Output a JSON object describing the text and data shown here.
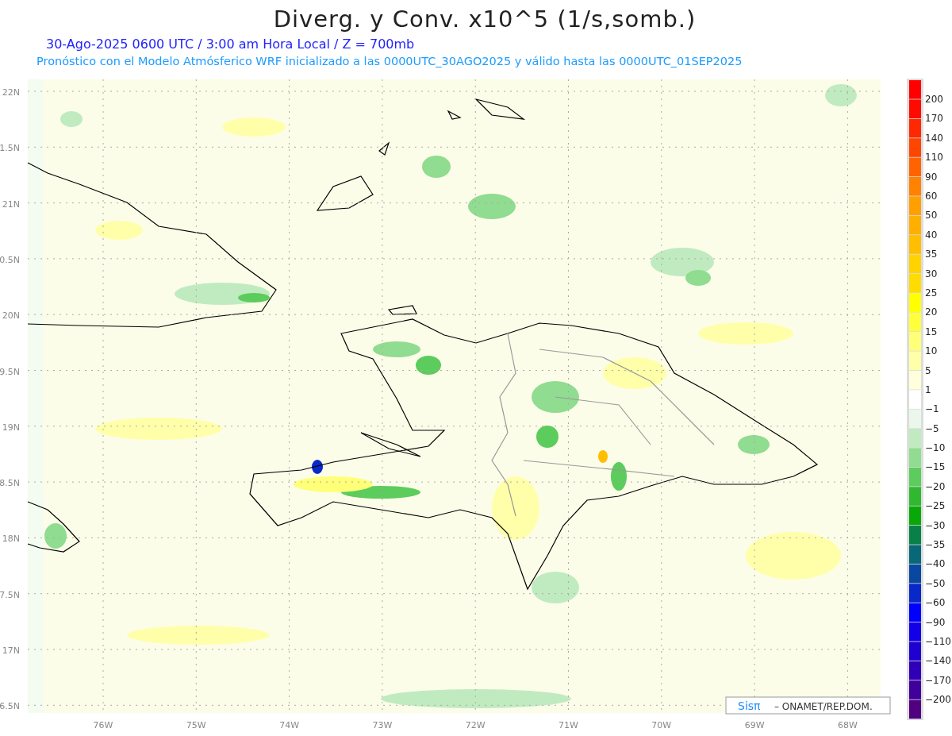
{
  "title": "Diverg. y Conv. x10^5 (1/s,somb.)",
  "subtitle": "30-Ago-2025  0600 UTC / 3:00 am Hora Local / Z = 700mb",
  "forecast_note": "Pronóstico con el Modelo Atmósferico WRF inicializado a las 0000UTC_30AGO2025 y válido hasta las  0000UTC_01SEP2025",
  "map": {
    "lat_labels": [
      "22N",
      "1.5N",
      "21N",
      "0.5N",
      "20N",
      "9.5N",
      "19N",
      "8.5N",
      "18N",
      "7.5N",
      "17N",
      "6.5N"
    ],
    "lon_labels": [
      "76W",
      "75W",
      "74W",
      "73W",
      "72W",
      "71W",
      "70W",
      "69W",
      "68W"
    ]
  },
  "credit": {
    "logo": "Sisπ",
    "text": "– ONAMET/REP.DOM."
  },
  "color_scale": {
    "segments": [
      {
        "color": "#ff0000"
      },
      {
        "color": "#ff0a00"
      },
      {
        "color": "#ff2800"
      },
      {
        "color": "#ff4600"
      },
      {
        "color": "#ff6400"
      },
      {
        "color": "#ff8200"
      },
      {
        "color": "#ffa000"
      },
      {
        "color": "#ffaf00"
      },
      {
        "color": "#ffbe00"
      },
      {
        "color": "#ffd200"
      },
      {
        "color": "#ffdc00"
      },
      {
        "color": "#ffff00"
      },
      {
        "color": "#ffff3c"
      },
      {
        "color": "#ffff78"
      },
      {
        "color": "#ffffaa"
      },
      {
        "color": "#ffffdc"
      },
      {
        "color": "#ffffff"
      },
      {
        "color": "#ebf7eb"
      },
      {
        "color": "#c0ebc0"
      },
      {
        "color": "#90dc90"
      },
      {
        "color": "#5ccc5c"
      },
      {
        "color": "#30b830"
      },
      {
        "color": "#08a808"
      },
      {
        "color": "#088048"
      },
      {
        "color": "#086878"
      },
      {
        "color": "#0848a0"
      },
      {
        "color": "#0828c8"
      },
      {
        "color": "#0000ff"
      },
      {
        "color": "#1400e6"
      },
      {
        "color": "#2000d0"
      },
      {
        "color": "#3000b8"
      },
      {
        "color": "#40009c"
      },
      {
        "color": "#500080"
      }
    ],
    "labels": [
      "200",
      "170",
      "140",
      "110",
      "90",
      "60",
      "50",
      "40",
      "35",
      "30",
      "25",
      "20",
      "15",
      "10",
      "5",
      "1",
      "−1",
      "−5",
      "−10",
      "−15",
      "−20",
      "−25",
      "−30",
      "−35",
      "−40",
      "−50",
      "−60",
      "−90",
      "−110",
      "−140",
      "−170",
      "−200"
    ]
  }
}
